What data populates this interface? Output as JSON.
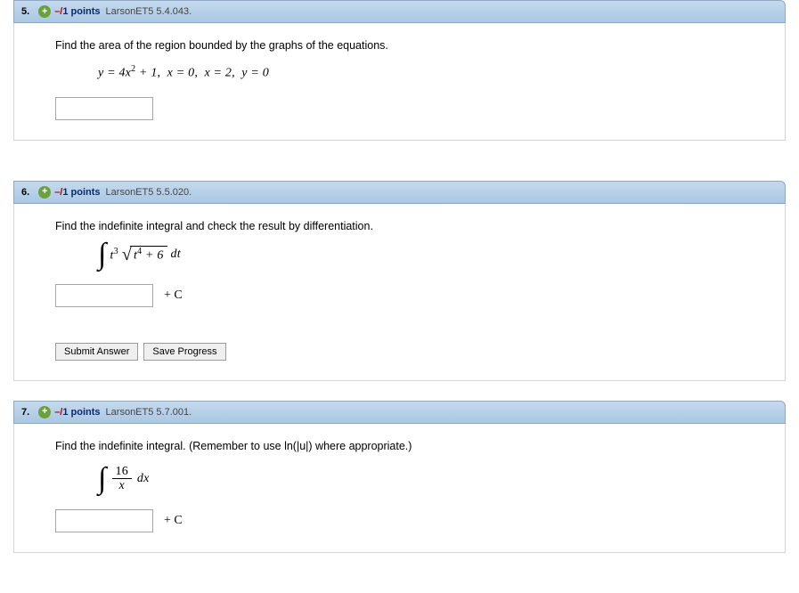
{
  "questions": [
    {
      "number": "5.",
      "points": "–/1 points",
      "source": "LarsonET5 5.4.043.",
      "prompt": "Find the area of the region bounded by the graphs of the equations.",
      "formula_plain": "y = 4x² + 1,  x = 0,  x = 2,  y = 0",
      "has_C": false,
      "has_buttons": false,
      "integral": null,
      "plusC": ""
    },
    {
      "number": "6.",
      "points": "–/1 points",
      "source": "LarsonET5 5.5.020.",
      "prompt": "Find the indefinite integral and check the result by differentiation.",
      "formula_plain": null,
      "integral": {
        "prefix": "t³",
        "radicand": "t⁴ + 6",
        "suffix": "dt"
      },
      "has_C": true,
      "plusC": "+ C",
      "has_buttons": true
    },
    {
      "number": "7.",
      "points": "–/1 points",
      "source": "LarsonET5 5.7.001.",
      "prompt": "Find the indefinite integral. (Remember to use ln(|u|) where appropriate.)",
      "formula_plain": null,
      "frac_integral": {
        "num": "16",
        "den": "x",
        "suffix": "dx"
      },
      "has_C": true,
      "plusC": "+ C",
      "has_buttons": false
    }
  ],
  "buttons": {
    "submit": "Submit Answer",
    "save": "Save Progress"
  }
}
